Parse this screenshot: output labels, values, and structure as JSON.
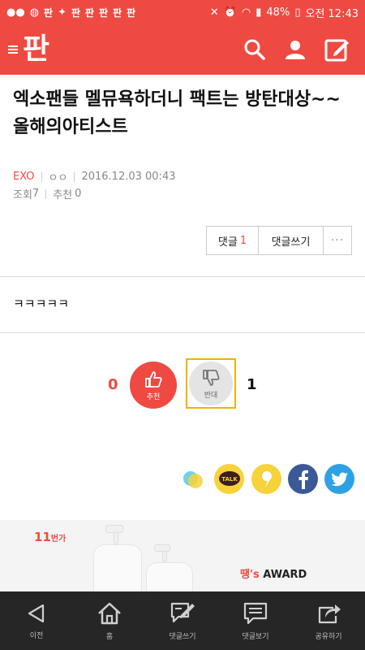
{
  "status_bar": {
    "app_glyphs": [
      "판",
      "판",
      "판",
      "판",
      "판",
      "판"
    ],
    "battery": "48%",
    "time": "오전 12:43"
  },
  "header": {
    "logo": "판"
  },
  "article": {
    "title": "엑소팬들 멜뮤욕하더니 팩트는 방탄대상~~ 올해의아티스트",
    "category": "EXO",
    "author": "ㅇㅇ",
    "date": "2016.12.03 00:43",
    "views_label": "조회",
    "views": "7",
    "recommend_label": "추천",
    "recommend": "0",
    "body": "ㅋㅋㅋㅋㅋ"
  },
  "actions": {
    "comments_label": "댓글",
    "comments_count": "1",
    "write_comment_label": "댓글쓰기",
    "more_label": "···"
  },
  "vote": {
    "up_count": "0",
    "up_label": "추천",
    "down_count": "1",
    "down_label": "반대"
  },
  "ad": {
    "brand_11": "11",
    "brand_11_suffix": "번가",
    "award_prefix": "땡's",
    "award": "AWARD"
  },
  "bottom_nav": {
    "items": [
      {
        "label": "이전",
        "icon": "back-icon"
      },
      {
        "label": "홈",
        "icon": "home-icon"
      },
      {
        "label": "댓글쓰기",
        "icon": "write-comment-icon"
      },
      {
        "label": "댓글보기",
        "icon": "view-comments-icon"
      },
      {
        "label": "공유하기",
        "icon": "share-icon"
      }
    ]
  },
  "colors": {
    "brand": "#ef4a42",
    "nav_bg": "#262626",
    "highlight_border": "#f0b300"
  }
}
